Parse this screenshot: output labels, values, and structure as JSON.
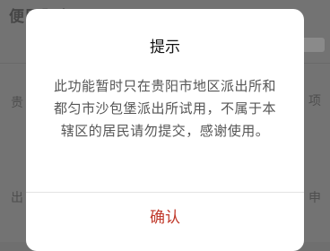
{
  "background": {
    "header_text": "便民服务",
    "fragments": [
      "贵",
      "项",
      "出",
      "申"
    ]
  },
  "dialog": {
    "title": "提示",
    "message": "此功能暂时只在贵阳市地区派出所和都匀市沙包堡派出所试用，不属于本辖区的居民请勿提交，感谢使用。",
    "confirm_label": "确认",
    "accent_color": "#c0392b"
  }
}
